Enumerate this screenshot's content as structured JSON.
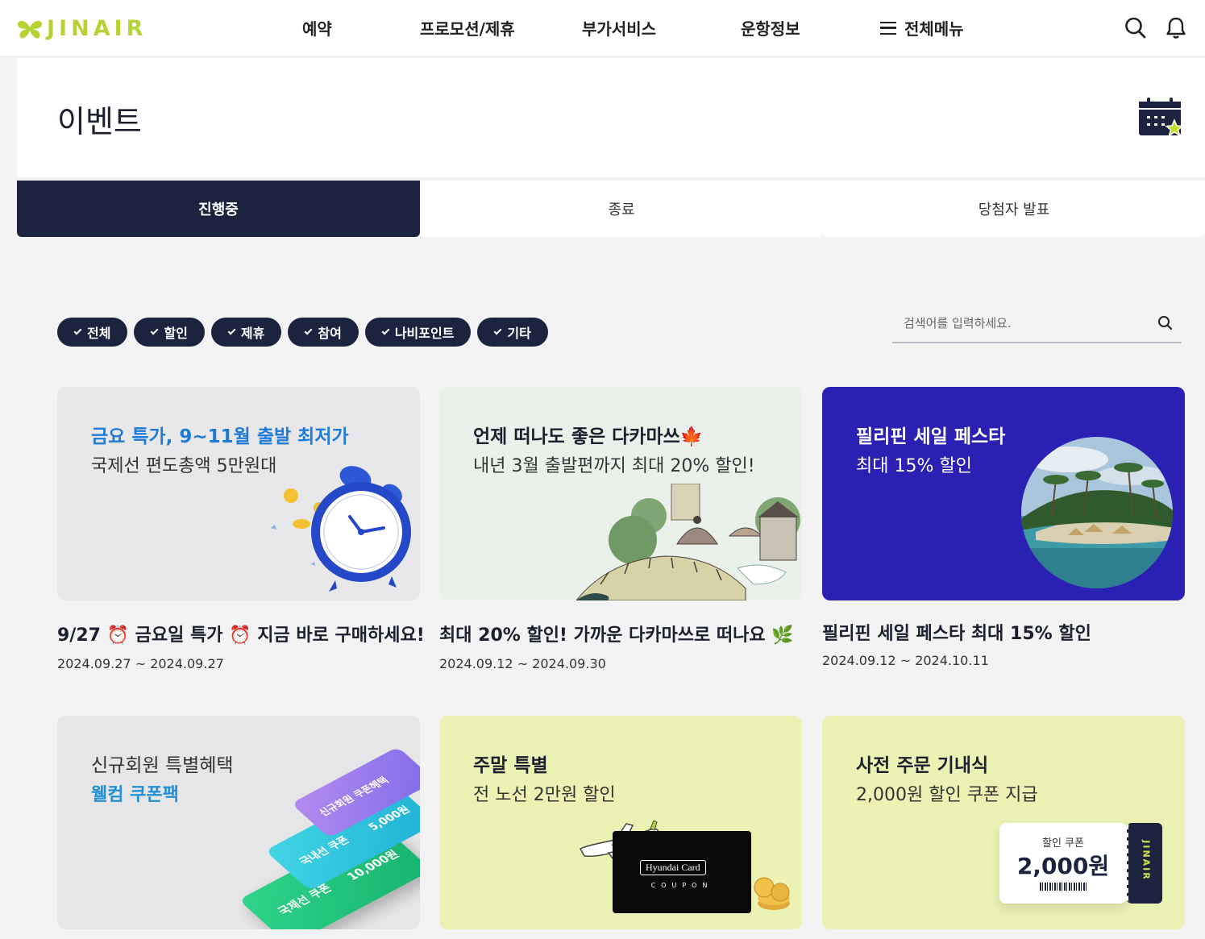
{
  "header": {
    "logo_text": "JINAIR",
    "nav": [
      "예약",
      "프로모션/제휴",
      "부가서비스",
      "운항정보"
    ],
    "menu_label": "전체메뉴",
    "icons": [
      "search-icon",
      "bell-icon"
    ],
    "brand_color": "#b5d334"
  },
  "page": {
    "title": "이벤트"
  },
  "tabs": [
    {
      "label": "진행중",
      "active": true
    },
    {
      "label": "종료",
      "active": false
    },
    {
      "label": "당첨자 발표",
      "active": false
    }
  ],
  "filters": [
    "전체",
    "할인",
    "제휴",
    "참여",
    "나비포인트",
    "기타"
  ],
  "search": {
    "placeholder": "검색어를 입력하세요."
  },
  "events": [
    {
      "banner_line1": "금요 특가, 9~11월 출발 최저가",
      "banner_line2": "국제선 편도총액 5만원대",
      "title": "9/27 ⏰ 금요일 특가 ⏰ 지금 바로 구매하세요!",
      "date": "2024.09.27 ~ 2024.09.27"
    },
    {
      "banner_line1": "언제 떠나도 좋은 다카마쓰🍁",
      "banner_line2": "내년 3월 출발편까지 최대 20% 할인!",
      "title": "최대 20% 할인! 가까운 다카마쓰로 떠나요 🌿",
      "date": "2024.09.12 ~ 2024.09.30"
    },
    {
      "banner_line1": "필리핀 세일 페스타",
      "banner_line2": "최대 15% 할인",
      "title": "필리핀 세일 페스타 최대 15% 할인",
      "date": "2024.09.12 ~ 2024.10.11"
    },
    {
      "banner_line1": "신규회원 특별혜택",
      "banner_line2": "웰컴 쿠폰팩",
      "coupon_a": "국제선 쿠폰",
      "coupon_a_value": "10,000원",
      "coupon_b": "국내선 쿠폰",
      "coupon_b_value": "5,000원",
      "coupon_c": "신규회원 쿠폰혜택"
    },
    {
      "banner_line1": "주말 특별",
      "banner_line2": "전 노선 2만원 할인",
      "card_brand": "Hyundai Card",
      "card_sub": "COUPON"
    },
    {
      "banner_line1": "사전 주문 기내식",
      "banner_line2": "2,000원 할인 쿠폰 지급",
      "coupon_label": "할인 쿠폰",
      "coupon_value": "2,000원",
      "stub_text": "JINAIR"
    }
  ]
}
